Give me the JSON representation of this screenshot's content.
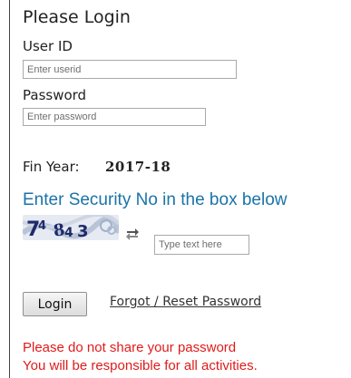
{
  "login": {
    "title": "Please Login",
    "userid_label": "User ID",
    "userid_placeholder": "Enter userid",
    "password_label": "Password",
    "password_placeholder": "Enter password"
  },
  "fin_year": {
    "label": "Fin Year:",
    "value": "2017-18"
  },
  "security": {
    "heading": "Enter Security No in the box below",
    "captcha_text": "74843",
    "refresh_icon": "refresh-arrows-icon",
    "input_placeholder": "Type text here"
  },
  "actions": {
    "login_label": "Login",
    "forgot_label": "Forgot / Reset Password"
  },
  "warnings": {
    "line1": "Please do not share your password",
    "line2": "You will be responsible for all activities."
  },
  "colors": {
    "heading_blue": "#1a73a8",
    "warning_red": "#e01b1b"
  }
}
